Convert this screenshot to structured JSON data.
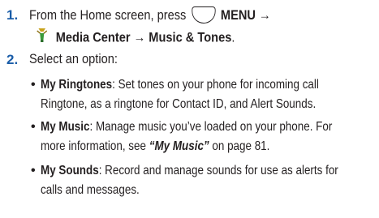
{
  "steps": [
    {
      "num": "1.",
      "line1_prefix": "From the Home screen, press",
      "line1_menu": "MENU",
      "arrow": "→",
      "line2_media": "Media Center",
      "line2_music": "Music & Tones",
      "line2_end": "."
    },
    {
      "num": "2.",
      "text": "Select an option:"
    }
  ],
  "options": [
    {
      "name": "My Ringtones",
      "desc_line1": ": Set tones on your phone for incoming call",
      "desc_line2": "Ringtone, as a ringtone for Contact ID, and Alert Sounds."
    },
    {
      "name": "My Music",
      "desc_line1": ": Manage music you’ve loaded on your phone. For",
      "desc_line2_prefix": "more information, see ",
      "desc_line2_link": "“My Music”",
      "desc_line2_suffix": " on page 81."
    },
    {
      "name": "My Sounds",
      "desc_line1": ": Record and manage sounds for use as alerts for",
      "desc_line2": "calls and messages."
    }
  ],
  "icons": {
    "menu_key": "menu-key-icon",
    "media_center": "media-center-icon"
  }
}
